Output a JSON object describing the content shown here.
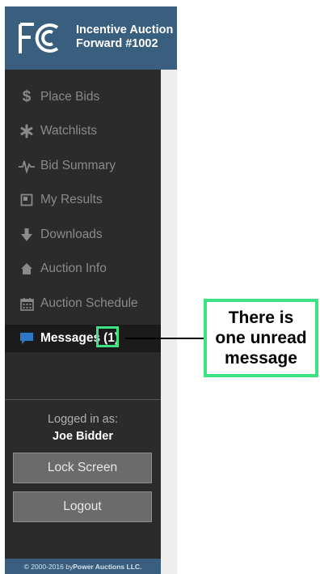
{
  "header": {
    "app_title_line1": "Incentive Auction",
    "app_title_line2": "Forward #1002"
  },
  "nav": {
    "items": [
      {
        "label": "Place Bids",
        "icon": "dollar-icon"
      },
      {
        "label": "Watchlists",
        "icon": "asterisk-icon"
      },
      {
        "label": "Bid Summary",
        "icon": "pulse-icon"
      },
      {
        "label": "My Results",
        "icon": "document-icon"
      },
      {
        "label": "Downloads",
        "icon": "download-arrow-icon"
      },
      {
        "label": "Auction Info",
        "icon": "home-icon"
      },
      {
        "label": "Auction Schedule",
        "icon": "calendar-icon"
      },
      {
        "label": "Messages",
        "icon": "message-icon",
        "badge": "(1)",
        "active": true
      }
    ]
  },
  "session": {
    "logged_in_label": "Logged in as:",
    "user_name": "Joe Bidder",
    "lock_button": "Lock Screen",
    "logout_button": "Logout"
  },
  "footer": {
    "copyright_prefix": "© 2000-2016 by ",
    "company": "Power Auctions LLC."
  },
  "annotation": {
    "callout_text": "There is one unread message"
  },
  "colors": {
    "sidebar_bg": "#2b2b2b",
    "header_bg": "#3a5f7e",
    "highlight_green": "#3de283",
    "active_item_bg": "#1b1b1b"
  }
}
